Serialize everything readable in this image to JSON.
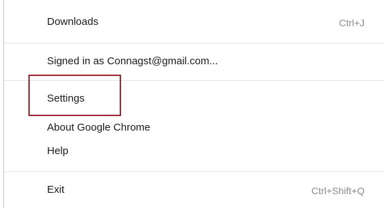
{
  "menu": {
    "downloads": {
      "label": "Downloads",
      "shortcut": "Ctrl+J"
    },
    "signed_in": {
      "label": "Signed in as Connagst@gmail.com..."
    },
    "settings": {
      "label": "Settings"
    },
    "about": {
      "label": "About Google Chrome"
    },
    "help": {
      "label": "Help"
    },
    "exit": {
      "label": "Exit",
      "shortcut": "Ctrl+Shift+Q"
    }
  },
  "highlight": {
    "color": "#b3202a"
  }
}
